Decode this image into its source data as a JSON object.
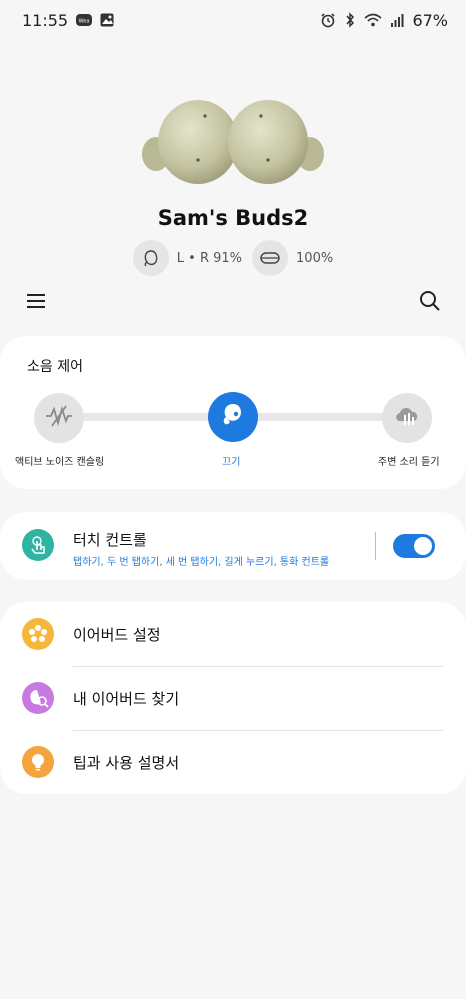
{
  "status_bar": {
    "time": "11:55",
    "battery_percent": "67%",
    "left_icons": [
      "weather-badge-icon",
      "gallery-icon"
    ],
    "right_icons": [
      "alarm-icon",
      "bluetooth-icon",
      "wifi-icon",
      "signal-icon"
    ]
  },
  "device": {
    "name": "Sam's Buds2",
    "earbuds_battery": "L • R 91%",
    "case_battery": "100%"
  },
  "toolbar": {
    "menu_icon": "hamburger-menu-icon",
    "search_icon": "search-icon"
  },
  "noise_control": {
    "title": "소음 제어",
    "modes": [
      {
        "label": "액티브 노이즈 캔슬링",
        "icon": "anc-icon"
      },
      {
        "label": "끄기",
        "icon": "earbud-off-icon"
      },
      {
        "label": "주변 소리 듣기",
        "icon": "ambient-sound-icon"
      }
    ],
    "selected": 1
  },
  "touch_controls": {
    "title": "터치 컨트롤",
    "subtitle": "탭하기, 두 번 탭하기, 세 번 탭하기, 길게 누르기, 통화 컨트롤",
    "enabled": true
  },
  "menu": {
    "items": [
      {
        "label": "이어버드 설정",
        "icon": "gear-flower-icon",
        "color": "#f6b73c"
      },
      {
        "label": "내 이어버드 찾기",
        "icon": "find-earbuds-icon",
        "color": "#c77be0"
      },
      {
        "label": "팁과 사용 설명서",
        "icon": "lightbulb-icon",
        "color": "#f5a33c"
      }
    ]
  },
  "colors": {
    "accent": "#1f7ae0",
    "background": "#f6f6f6",
    "card": "#ffffff",
    "touch_icon_bg": "#2fb4a3",
    "earbud_body": "#c9c9a8"
  }
}
